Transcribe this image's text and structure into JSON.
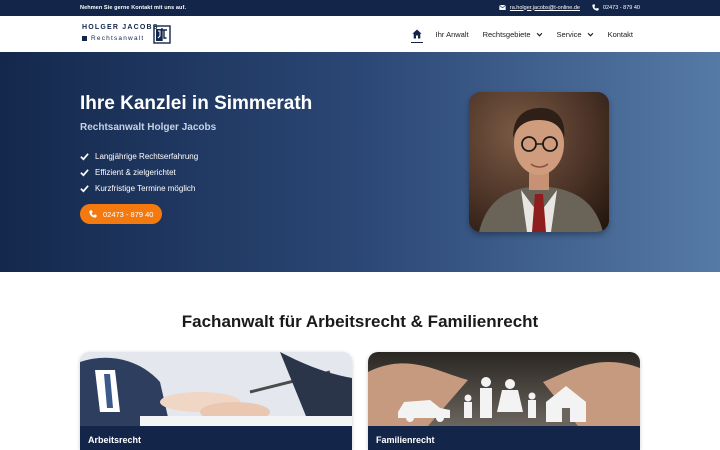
{
  "topbar": {
    "tagline": "Nehmen Sie gerne Kontakt mit uns auf.",
    "email": "ra.holger.jacobs@t-online.de",
    "phone": "02473 - 879 40",
    "email_icon": "envelope-icon",
    "phone_icon": "phone-icon"
  },
  "logo": {
    "line1": "HOLGER JACOBS",
    "line2": "Rechtsanwalt"
  },
  "nav": {
    "home_icon": "home-icon",
    "items": [
      {
        "label": "Ihr Anwalt"
      },
      {
        "label": "Rechtsgebiete",
        "dropdown": true
      },
      {
        "label": "Service",
        "dropdown": true
      },
      {
        "label": "Kontakt"
      }
    ]
  },
  "hero": {
    "title": "Ihre Kanzlei in Simmerath",
    "subtitle": "Rechtsanwalt Holger Jacobs",
    "features": [
      "Langjährige Rechtserfahrung",
      "Effizient & zielgerichtet",
      "Kurzfristige Termine möglich"
    ],
    "cta_label": "02473 - 879 40"
  },
  "section": {
    "title": "Fachanwalt für Arbeitsrecht & Familienrecht"
  },
  "cards": [
    {
      "title": "Arbeitsrecht"
    },
    {
      "title": "Familienrecht"
    }
  ],
  "colors": {
    "navy": "#13264a",
    "accent_orange": "#f47a10",
    "hero_gradient_start": "#14284c",
    "hero_gradient_end": "#567aa6"
  }
}
